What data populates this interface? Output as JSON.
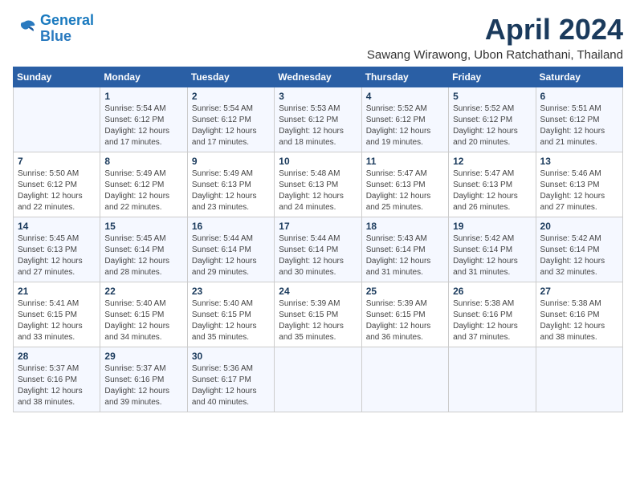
{
  "logo": {
    "line1": "General",
    "line2": "Blue"
  },
  "title": "April 2024",
  "location": "Sawang Wirawong, Ubon Ratchathani, Thailand",
  "weekdays": [
    "Sunday",
    "Monday",
    "Tuesday",
    "Wednesday",
    "Thursday",
    "Friday",
    "Saturday"
  ],
  "weeks": [
    [
      {
        "day": "",
        "info": ""
      },
      {
        "day": "1",
        "info": "Sunrise: 5:54 AM\nSunset: 6:12 PM\nDaylight: 12 hours\nand 17 minutes."
      },
      {
        "day": "2",
        "info": "Sunrise: 5:54 AM\nSunset: 6:12 PM\nDaylight: 12 hours\nand 17 minutes."
      },
      {
        "day": "3",
        "info": "Sunrise: 5:53 AM\nSunset: 6:12 PM\nDaylight: 12 hours\nand 18 minutes."
      },
      {
        "day": "4",
        "info": "Sunrise: 5:52 AM\nSunset: 6:12 PM\nDaylight: 12 hours\nand 19 minutes."
      },
      {
        "day": "5",
        "info": "Sunrise: 5:52 AM\nSunset: 6:12 PM\nDaylight: 12 hours\nand 20 minutes."
      },
      {
        "day": "6",
        "info": "Sunrise: 5:51 AM\nSunset: 6:12 PM\nDaylight: 12 hours\nand 21 minutes."
      }
    ],
    [
      {
        "day": "7",
        "info": "Sunrise: 5:50 AM\nSunset: 6:12 PM\nDaylight: 12 hours\nand 22 minutes."
      },
      {
        "day": "8",
        "info": "Sunrise: 5:49 AM\nSunset: 6:12 PM\nDaylight: 12 hours\nand 22 minutes."
      },
      {
        "day": "9",
        "info": "Sunrise: 5:49 AM\nSunset: 6:13 PM\nDaylight: 12 hours\nand 23 minutes."
      },
      {
        "day": "10",
        "info": "Sunrise: 5:48 AM\nSunset: 6:13 PM\nDaylight: 12 hours\nand 24 minutes."
      },
      {
        "day": "11",
        "info": "Sunrise: 5:47 AM\nSunset: 6:13 PM\nDaylight: 12 hours\nand 25 minutes."
      },
      {
        "day": "12",
        "info": "Sunrise: 5:47 AM\nSunset: 6:13 PM\nDaylight: 12 hours\nand 26 minutes."
      },
      {
        "day": "13",
        "info": "Sunrise: 5:46 AM\nSunset: 6:13 PM\nDaylight: 12 hours\nand 27 minutes."
      }
    ],
    [
      {
        "day": "14",
        "info": "Sunrise: 5:45 AM\nSunset: 6:13 PM\nDaylight: 12 hours\nand 27 minutes."
      },
      {
        "day": "15",
        "info": "Sunrise: 5:45 AM\nSunset: 6:14 PM\nDaylight: 12 hours\nand 28 minutes."
      },
      {
        "day": "16",
        "info": "Sunrise: 5:44 AM\nSunset: 6:14 PM\nDaylight: 12 hours\nand 29 minutes."
      },
      {
        "day": "17",
        "info": "Sunrise: 5:44 AM\nSunset: 6:14 PM\nDaylight: 12 hours\nand 30 minutes."
      },
      {
        "day": "18",
        "info": "Sunrise: 5:43 AM\nSunset: 6:14 PM\nDaylight: 12 hours\nand 31 minutes."
      },
      {
        "day": "19",
        "info": "Sunrise: 5:42 AM\nSunset: 6:14 PM\nDaylight: 12 hours\nand 31 minutes."
      },
      {
        "day": "20",
        "info": "Sunrise: 5:42 AM\nSunset: 6:14 PM\nDaylight: 12 hours\nand 32 minutes."
      }
    ],
    [
      {
        "day": "21",
        "info": "Sunrise: 5:41 AM\nSunset: 6:15 PM\nDaylight: 12 hours\nand 33 minutes."
      },
      {
        "day": "22",
        "info": "Sunrise: 5:40 AM\nSunset: 6:15 PM\nDaylight: 12 hours\nand 34 minutes."
      },
      {
        "day": "23",
        "info": "Sunrise: 5:40 AM\nSunset: 6:15 PM\nDaylight: 12 hours\nand 35 minutes."
      },
      {
        "day": "24",
        "info": "Sunrise: 5:39 AM\nSunset: 6:15 PM\nDaylight: 12 hours\nand 35 minutes."
      },
      {
        "day": "25",
        "info": "Sunrise: 5:39 AM\nSunset: 6:15 PM\nDaylight: 12 hours\nand 36 minutes."
      },
      {
        "day": "26",
        "info": "Sunrise: 5:38 AM\nSunset: 6:16 PM\nDaylight: 12 hours\nand 37 minutes."
      },
      {
        "day": "27",
        "info": "Sunrise: 5:38 AM\nSunset: 6:16 PM\nDaylight: 12 hours\nand 38 minutes."
      }
    ],
    [
      {
        "day": "28",
        "info": "Sunrise: 5:37 AM\nSunset: 6:16 PM\nDaylight: 12 hours\nand 38 minutes."
      },
      {
        "day": "29",
        "info": "Sunrise: 5:37 AM\nSunset: 6:16 PM\nDaylight: 12 hours\nand 39 minutes."
      },
      {
        "day": "30",
        "info": "Sunrise: 5:36 AM\nSunset: 6:17 PM\nDaylight: 12 hours\nand 40 minutes."
      },
      {
        "day": "",
        "info": ""
      },
      {
        "day": "",
        "info": ""
      },
      {
        "day": "",
        "info": ""
      },
      {
        "day": "",
        "info": ""
      }
    ]
  ]
}
